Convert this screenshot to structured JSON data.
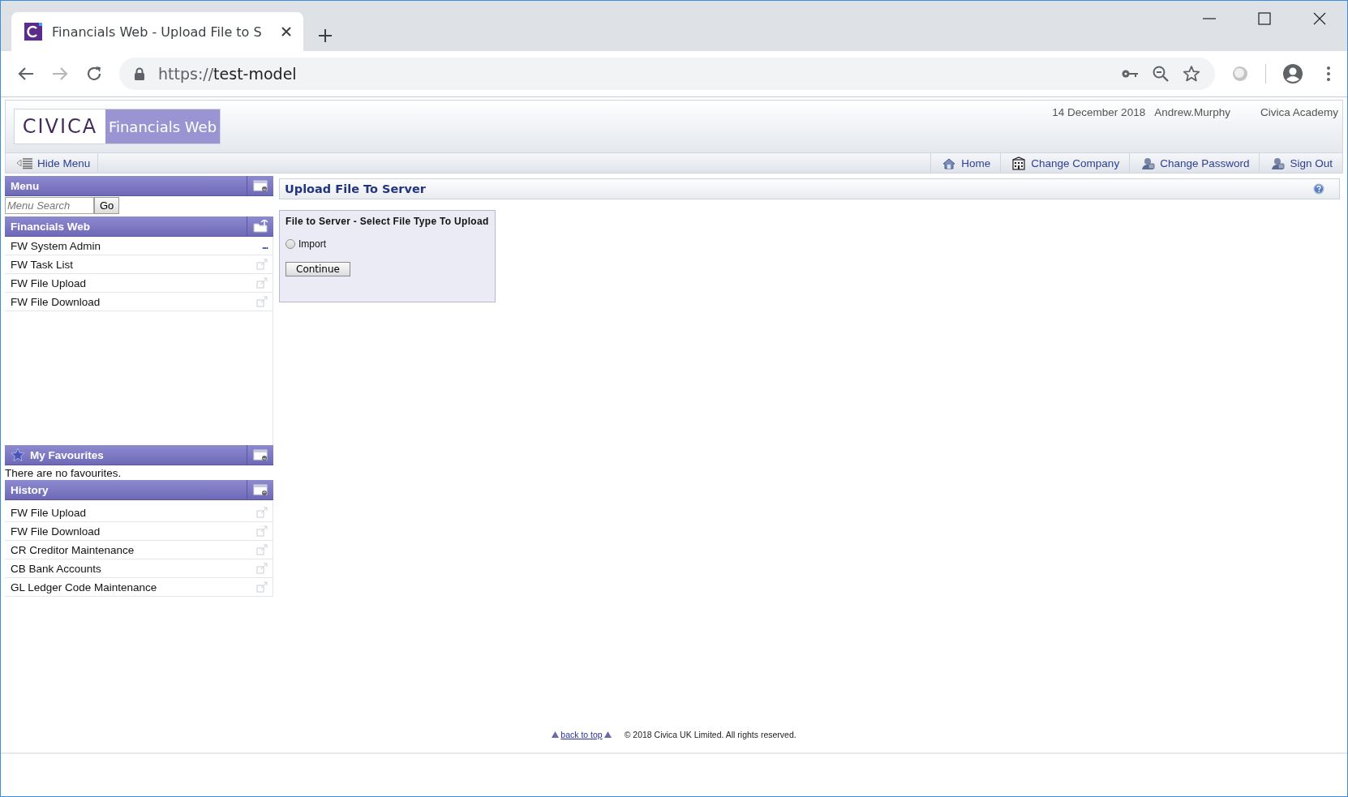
{
  "browser": {
    "tab_title": "Financials Web - Upload File to S",
    "url_scheme": "https://",
    "url_host": "test-model"
  },
  "header": {
    "logo": "CIVICA",
    "product": "Financials Web",
    "date": "14 December 2018",
    "user": "Andrew.Murphy",
    "organisation": "Civica Academy"
  },
  "nav": {
    "hide_menu": "Hide Menu",
    "links": [
      {
        "label": "Home",
        "kind": "home"
      },
      {
        "label": "Change Company",
        "kind": "company"
      },
      {
        "label": "Change Password",
        "kind": "account"
      },
      {
        "label": "Sign Out",
        "kind": "account"
      }
    ]
  },
  "sidebar": {
    "menu": {
      "title": "Menu",
      "search_placeholder": "Menu Search",
      "go": "Go"
    },
    "financials": {
      "title": "Financials Web",
      "items": [
        {
          "label": "FW System Admin",
          "kind": "submenu",
          "more": "..."
        },
        {
          "label": "FW Task List",
          "kind": "link"
        },
        {
          "label": "FW File Upload",
          "kind": "link"
        },
        {
          "label": "FW File Download",
          "kind": "link"
        }
      ]
    },
    "favourites": {
      "title": "My Favourites",
      "empty_text": "There are no favourites."
    },
    "history": {
      "title": "History",
      "items": [
        {
          "label": "FW File Upload",
          "kind": "link"
        },
        {
          "label": "FW File Download",
          "kind": "link"
        },
        {
          "label": "CR Creditor Maintenance",
          "kind": "link"
        },
        {
          "label": "CB Bank Accounts",
          "kind": "link"
        },
        {
          "label": "GL Ledger Code Maintenance",
          "kind": "link"
        }
      ]
    }
  },
  "content": {
    "title": "Upload File To Server",
    "panel": {
      "title": "File to Server - Select File Type To Upload",
      "options": [
        {
          "label": "Import",
          "selected": false
        }
      ],
      "button": "Continue"
    }
  },
  "footer": {
    "back_to_top": "back to top",
    "copyright": "© 2018 Civica UK Limited. All rights reserved."
  }
}
